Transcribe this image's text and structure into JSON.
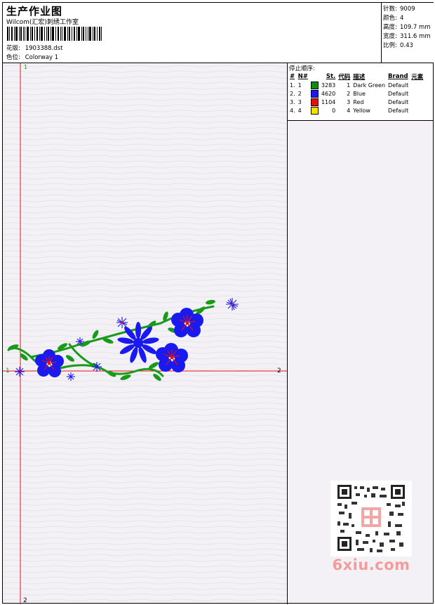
{
  "header": {
    "title": "生产作业图",
    "studio": "Wilcom(汇宏)刺绣工作室",
    "design_label": "花版:",
    "design_value": "1903388.dst",
    "colorway_label": "色位:",
    "colorway_value": "Colorway 1"
  },
  "stats": [
    {
      "label": "针数:",
      "value": "9009"
    },
    {
      "label": "颜色:",
      "value": "4"
    },
    {
      "label": "高度:",
      "value": "109.7 mm"
    },
    {
      "label": "宽度:",
      "value": "311.6 mm"
    },
    {
      "label": "比例:",
      "value": "0.43"
    }
  ],
  "stop_sequence": {
    "title": "停止顺序:",
    "headers": [
      "#",
      "N#",
      "St.",
      "代码",
      "描述",
      "Brand",
      "元素"
    ],
    "rows": [
      {
        "idx": "1.",
        "n": "1",
        "color": "#0e8a16",
        "stitches": "3283",
        "code": "1",
        "desc": "Dark Green",
        "brand": "Default"
      },
      {
        "idx": "2.",
        "n": "2",
        "color": "#1a1aef",
        "stitches": "4620",
        "code": "2",
        "desc": "Blue",
        "brand": "Default"
      },
      {
        "idx": "3.",
        "n": "3",
        "color": "#e41010",
        "stitches": "1104",
        "code": "3",
        "desc": "Red",
        "brand": "Default"
      },
      {
        "idx": "4.",
        "n": "4",
        "color": "#f5e000",
        "stitches": "0",
        "code": "4",
        "desc": "Yellow",
        "brand": "Default"
      }
    ]
  },
  "canvas": {
    "axis_marks": {
      "v_top": "1",
      "v_bottom": "2",
      "h_left": "1",
      "h_right": "2"
    }
  },
  "colors": {
    "green": "#1a9a1a",
    "blue": "#1a1aef",
    "red": "#e41010",
    "axis": "#e01818"
  },
  "watermark": "6xiu.com",
  "qr_icon": "qr-code-icon"
}
